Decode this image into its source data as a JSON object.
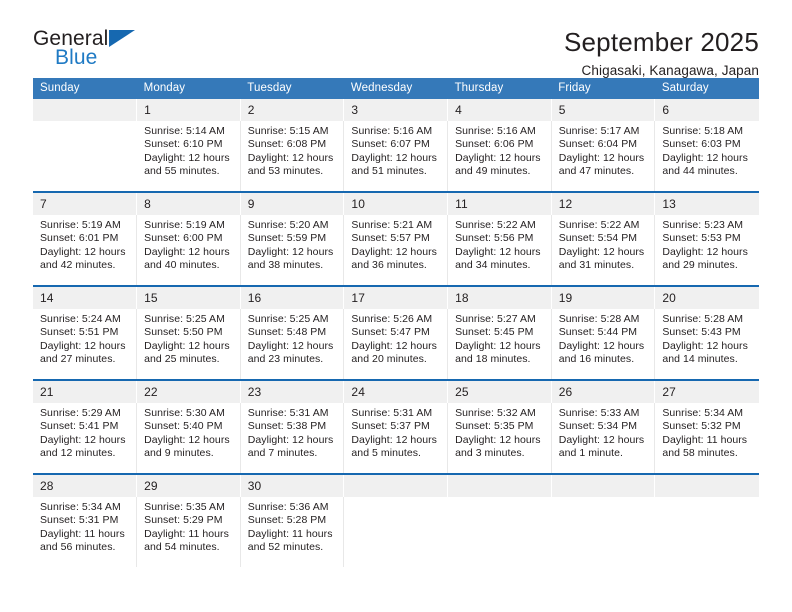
{
  "brand": {
    "name_part1": "General",
    "name_part2": "Blue"
  },
  "header": {
    "title": "September 2025",
    "location": "Chigasaki, Kanagawa, Japan"
  },
  "weekday_headers": [
    "Sunday",
    "Monday",
    "Tuesday",
    "Wednesday",
    "Thursday",
    "Friday",
    "Saturday"
  ],
  "colors": {
    "header_blue": "#3579b9",
    "separator_blue": "#1668b0",
    "brand_blue": "#1f7ac4",
    "number_band": "#f0f0f0",
    "text": "#231f20"
  },
  "weeks": [
    [
      {
        "day": "",
        "sunrise": "",
        "sunset": "",
        "daylight_1": "",
        "daylight_2": ""
      },
      {
        "day": "1",
        "sunrise": "Sunrise: 5:14 AM",
        "sunset": "Sunset: 6:10 PM",
        "daylight_1": "Daylight: 12 hours",
        "daylight_2": "and 55 minutes."
      },
      {
        "day": "2",
        "sunrise": "Sunrise: 5:15 AM",
        "sunset": "Sunset: 6:08 PM",
        "daylight_1": "Daylight: 12 hours",
        "daylight_2": "and 53 minutes."
      },
      {
        "day": "3",
        "sunrise": "Sunrise: 5:16 AM",
        "sunset": "Sunset: 6:07 PM",
        "daylight_1": "Daylight: 12 hours",
        "daylight_2": "and 51 minutes."
      },
      {
        "day": "4",
        "sunrise": "Sunrise: 5:16 AM",
        "sunset": "Sunset: 6:06 PM",
        "daylight_1": "Daylight: 12 hours",
        "daylight_2": "and 49 minutes."
      },
      {
        "day": "5",
        "sunrise": "Sunrise: 5:17 AM",
        "sunset": "Sunset: 6:04 PM",
        "daylight_1": "Daylight: 12 hours",
        "daylight_2": "and 47 minutes."
      },
      {
        "day": "6",
        "sunrise": "Sunrise: 5:18 AM",
        "sunset": "Sunset: 6:03 PM",
        "daylight_1": "Daylight: 12 hours",
        "daylight_2": "and 44 minutes."
      }
    ],
    [
      {
        "day": "7",
        "sunrise": "Sunrise: 5:19 AM",
        "sunset": "Sunset: 6:01 PM",
        "daylight_1": "Daylight: 12 hours",
        "daylight_2": "and 42 minutes."
      },
      {
        "day": "8",
        "sunrise": "Sunrise: 5:19 AM",
        "sunset": "Sunset: 6:00 PM",
        "daylight_1": "Daylight: 12 hours",
        "daylight_2": "and 40 minutes."
      },
      {
        "day": "9",
        "sunrise": "Sunrise: 5:20 AM",
        "sunset": "Sunset: 5:59 PM",
        "daylight_1": "Daylight: 12 hours",
        "daylight_2": "and 38 minutes."
      },
      {
        "day": "10",
        "sunrise": "Sunrise: 5:21 AM",
        "sunset": "Sunset: 5:57 PM",
        "daylight_1": "Daylight: 12 hours",
        "daylight_2": "and 36 minutes."
      },
      {
        "day": "11",
        "sunrise": "Sunrise: 5:22 AM",
        "sunset": "Sunset: 5:56 PM",
        "daylight_1": "Daylight: 12 hours",
        "daylight_2": "and 34 minutes."
      },
      {
        "day": "12",
        "sunrise": "Sunrise: 5:22 AM",
        "sunset": "Sunset: 5:54 PM",
        "daylight_1": "Daylight: 12 hours",
        "daylight_2": "and 31 minutes."
      },
      {
        "day": "13",
        "sunrise": "Sunrise: 5:23 AM",
        "sunset": "Sunset: 5:53 PM",
        "daylight_1": "Daylight: 12 hours",
        "daylight_2": "and 29 minutes."
      }
    ],
    [
      {
        "day": "14",
        "sunrise": "Sunrise: 5:24 AM",
        "sunset": "Sunset: 5:51 PM",
        "daylight_1": "Daylight: 12 hours",
        "daylight_2": "and 27 minutes."
      },
      {
        "day": "15",
        "sunrise": "Sunrise: 5:25 AM",
        "sunset": "Sunset: 5:50 PM",
        "daylight_1": "Daylight: 12 hours",
        "daylight_2": "and 25 minutes."
      },
      {
        "day": "16",
        "sunrise": "Sunrise: 5:25 AM",
        "sunset": "Sunset: 5:48 PM",
        "daylight_1": "Daylight: 12 hours",
        "daylight_2": "and 23 minutes."
      },
      {
        "day": "17",
        "sunrise": "Sunrise: 5:26 AM",
        "sunset": "Sunset: 5:47 PM",
        "daylight_1": "Daylight: 12 hours",
        "daylight_2": "and 20 minutes."
      },
      {
        "day": "18",
        "sunrise": "Sunrise: 5:27 AM",
        "sunset": "Sunset: 5:45 PM",
        "daylight_1": "Daylight: 12 hours",
        "daylight_2": "and 18 minutes."
      },
      {
        "day": "19",
        "sunrise": "Sunrise: 5:28 AM",
        "sunset": "Sunset: 5:44 PM",
        "daylight_1": "Daylight: 12 hours",
        "daylight_2": "and 16 minutes."
      },
      {
        "day": "20",
        "sunrise": "Sunrise: 5:28 AM",
        "sunset": "Sunset: 5:43 PM",
        "daylight_1": "Daylight: 12 hours",
        "daylight_2": "and 14 minutes."
      }
    ],
    [
      {
        "day": "21",
        "sunrise": "Sunrise: 5:29 AM",
        "sunset": "Sunset: 5:41 PM",
        "daylight_1": "Daylight: 12 hours",
        "daylight_2": "and 12 minutes."
      },
      {
        "day": "22",
        "sunrise": "Sunrise: 5:30 AM",
        "sunset": "Sunset: 5:40 PM",
        "daylight_1": "Daylight: 12 hours",
        "daylight_2": "and 9 minutes."
      },
      {
        "day": "23",
        "sunrise": "Sunrise: 5:31 AM",
        "sunset": "Sunset: 5:38 PM",
        "daylight_1": "Daylight: 12 hours",
        "daylight_2": "and 7 minutes."
      },
      {
        "day": "24",
        "sunrise": "Sunrise: 5:31 AM",
        "sunset": "Sunset: 5:37 PM",
        "daylight_1": "Daylight: 12 hours",
        "daylight_2": "and 5 minutes."
      },
      {
        "day": "25",
        "sunrise": "Sunrise: 5:32 AM",
        "sunset": "Sunset: 5:35 PM",
        "daylight_1": "Daylight: 12 hours",
        "daylight_2": "and 3 minutes."
      },
      {
        "day": "26",
        "sunrise": "Sunrise: 5:33 AM",
        "sunset": "Sunset: 5:34 PM",
        "daylight_1": "Daylight: 12 hours",
        "daylight_2": "and 1 minute."
      },
      {
        "day": "27",
        "sunrise": "Sunrise: 5:34 AM",
        "sunset": "Sunset: 5:32 PM",
        "daylight_1": "Daylight: 11 hours",
        "daylight_2": "and 58 minutes."
      }
    ],
    [
      {
        "day": "28",
        "sunrise": "Sunrise: 5:34 AM",
        "sunset": "Sunset: 5:31 PM",
        "daylight_1": "Daylight: 11 hours",
        "daylight_2": "and 56 minutes."
      },
      {
        "day": "29",
        "sunrise": "Sunrise: 5:35 AM",
        "sunset": "Sunset: 5:29 PM",
        "daylight_1": "Daylight: 11 hours",
        "daylight_2": "and 54 minutes."
      },
      {
        "day": "30",
        "sunrise": "Sunrise: 5:36 AM",
        "sunset": "Sunset: 5:28 PM",
        "daylight_1": "Daylight: 11 hours",
        "daylight_2": "and 52 minutes."
      },
      {
        "day": "",
        "sunrise": "",
        "sunset": "",
        "daylight_1": "",
        "daylight_2": ""
      },
      {
        "day": "",
        "sunrise": "",
        "sunset": "",
        "daylight_1": "",
        "daylight_2": ""
      },
      {
        "day": "",
        "sunrise": "",
        "sunset": "",
        "daylight_1": "",
        "daylight_2": ""
      },
      {
        "day": "",
        "sunrise": "",
        "sunset": "",
        "daylight_1": "",
        "daylight_2": ""
      }
    ]
  ]
}
